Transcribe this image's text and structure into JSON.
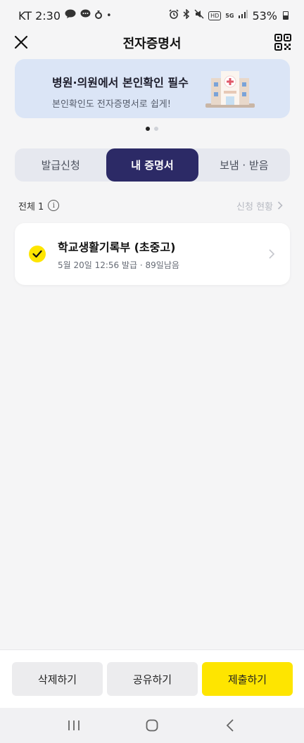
{
  "status_bar": {
    "carrier_time": "KT 2:30",
    "network": "5G",
    "hd": "HD",
    "battery": "53%"
  },
  "header": {
    "title": "전자증명서"
  },
  "banner": {
    "title": "병원·의원에서 본인확인 필수",
    "subtitle": "본인확인도 전자증명서로 쉽게!"
  },
  "tabs": [
    {
      "label": "발급신청",
      "active": false
    },
    {
      "label": "내 증명서",
      "active": true
    },
    {
      "label": "보냄 · 받음",
      "active": false
    }
  ],
  "list_header": {
    "total": "전체 1",
    "status_link": "신청 현황"
  },
  "certificate": {
    "title": "학교생활기록부 (초중고)",
    "meta": "5월 20일 12:56 발급 · 89일남음"
  },
  "buttons": {
    "delete": "삭제하기",
    "share": "공유하기",
    "submit": "제출하기"
  },
  "colors": {
    "accent_yellow": "#fee500",
    "tab_active": "#2c2a66",
    "banner_bg": "#dbe5f6"
  }
}
